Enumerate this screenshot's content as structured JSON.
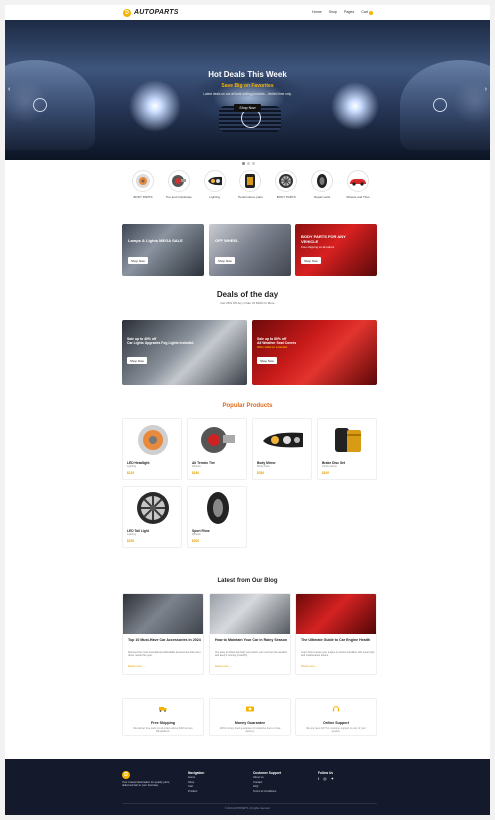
{
  "header": {
    "logo_mark": "D",
    "logo_text": "AUTOPARTS",
    "nav": [
      "Home",
      "Shop",
      "Pages",
      "Cart"
    ]
  },
  "hero": {
    "title": "Hot Deals This Week",
    "subtitle": "Save Big on Favorites",
    "description": "Latest deals on our all best-selling products – limited time only.",
    "button": "Shop Now",
    "prev_icon": "‹",
    "next_icon": "›"
  },
  "categories": [
    {
      "label": "BODY PARTS",
      "icon": "body-parts-icon"
    },
    {
      "label": "Tire and Crankcase",
      "icon": "turbo-icon"
    },
    {
      "label": "Lighting",
      "icon": "headlight-icon"
    },
    {
      "label": "Performance parts",
      "icon": "oil-filter-icon"
    },
    {
      "label": "BODY PARTS",
      "icon": "rim-icon"
    },
    {
      "label": "Repair parts",
      "icon": "tire-icon"
    },
    {
      "label": "Wheels and Tires",
      "icon": "red-car-icon"
    }
  ],
  "promos": [
    {
      "title": "Lamps & Lights MEGA SALE",
      "small": "",
      "button": "Shop Now"
    },
    {
      "title": "OFF WHEEL",
      "small": "",
      "button": "Shop Now"
    },
    {
      "title": "BODY PARTS FOR ANY VEHICLE",
      "small": "Free shipping on all orders",
      "button": "Shop Now"
    }
  ],
  "deals_section": {
    "title": "Deals of the day",
    "subtitle": "Get 25% Off Any Order Of $100 Or More"
  },
  "deals": [
    {
      "tag": "Sale up to 40% off",
      "title": "Car Lights Upgrades Fog Lights Included",
      "button": "Shop Now"
    },
    {
      "tag": "Sale up to 80% off",
      "title": "All Weather Seat Covers",
      "small": "Offer valid on selected",
      "button": "Shop Now"
    }
  ],
  "popular": {
    "title": "Popular Products",
    "items": [
      {
        "name": "LED Headlight",
        "category": "Lighting",
        "price": "$120"
      },
      {
        "name": "All Terrain Tire",
        "category": "Wheels",
        "price": "$180"
      },
      {
        "name": "Body Mirror",
        "category": "Body Parts",
        "price": "$250"
      },
      {
        "name": "Brake Disc Set",
        "category": "Performance",
        "price": "$100"
      },
      {
        "name": "LED Tail Light",
        "category": "Lighting",
        "price": "$150"
      },
      {
        "name": "Sport Rims",
        "category": "Wheels",
        "price": "$200"
      }
    ]
  },
  "blog": {
    "title": "Latest from Our Blog",
    "posts": [
      {
        "title": "Top 10 Must-Have Car Accessories in 2024",
        "excerpt": "Discover the most essential and affordable accessories that every driver needs this year.",
        "more": "Read more →"
      },
      {
        "title": "How to Maintain Your Car in Rainy Season",
        "excerpt": "Our easy to follow tips help you protect your car from the weather and keep it running smoothly.",
        "more": "Read more →"
      },
      {
        "title": "The Ultimate Guide to Car Engine Health",
        "excerpt": "Learn how to keep your engine in perfect condition with expert tips and maintenance advice.",
        "more": "Read more →"
      }
    ]
  },
  "features": [
    {
      "title": "Free Shipping",
      "desc": "We deliver free parts on all orders above $100 across Bangladesh."
    },
    {
      "title": "Money Guarantee",
      "desc": "100% money back guarantee for defective items or late delivery."
    },
    {
      "title": "Online Support",
      "desc": "We are here 24/7 for customer support on any of your queries."
    }
  ],
  "footer": {
    "logo_mark": "D",
    "about": "Your trusted destination for quality parts, delivered fast to your doorstep.",
    "navigation": {
      "heading": "Navigation",
      "links": [
        "Home",
        "Shop",
        "Cart",
        "Product"
      ]
    },
    "support": {
      "heading": "Customer Support",
      "links": [
        "About us",
        "Contact",
        "FAQ",
        "Terms & Conditions"
      ]
    },
    "follow": {
      "heading": "Follow Us",
      "icons": [
        "f",
        "◎",
        "✦"
      ]
    },
    "copyright": "© 2024 AUTOPARTS. All rights reserved."
  },
  "colors": {
    "accent": "#f6b400",
    "footer_bg": "#141a2b",
    "popular_title": "#e06a1a"
  }
}
